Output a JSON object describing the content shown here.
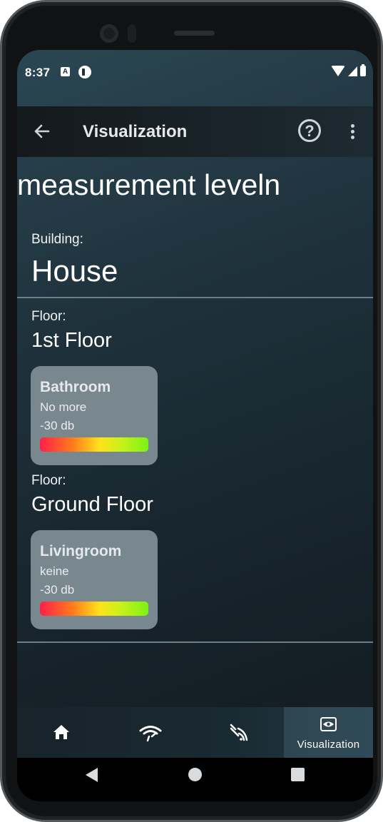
{
  "status_bar": {
    "time": "8:37",
    "notification_icons": [
      "app-a-icon",
      "app-shield-icon"
    ],
    "system_icons": [
      "wifi-icon",
      "cellular-signal-icon",
      "battery-icon"
    ]
  },
  "app_bar": {
    "back_icon": "arrow-left-icon",
    "title": "Visualization",
    "help_icon": "help-circle-icon",
    "help_glyph": "?",
    "more_icon": "more-vertical-icon"
  },
  "page": {
    "heading": "measurement leveln"
  },
  "building": {
    "label": "Building:",
    "name": "House"
  },
  "floors": [
    {
      "label": "Floor:",
      "name": "1st Floor",
      "rooms": [
        {
          "name": "Bathroom",
          "status": "No more",
          "level": "-30 db"
        }
      ]
    },
    {
      "label": "Floor:",
      "name": "Ground Floor",
      "rooms": [
        {
          "name": "Livingroom",
          "status": "keine",
          "level": "-30 db"
        }
      ]
    }
  ],
  "colors": {
    "level_gradient": [
      "#ff1f4a",
      "#ff7a1c",
      "#ffe21a",
      "#c8f21a",
      "#7bf215"
    ],
    "card_background": "#79878f"
  },
  "bottom_nav": {
    "items": [
      {
        "icon": "home-icon",
        "label": ""
      },
      {
        "icon": "wifi-router-icon",
        "label": ""
      },
      {
        "icon": "signal-waves-icon",
        "label": ""
      },
      {
        "icon": "eye-visualization-icon",
        "label": "Visualization",
        "active": true
      }
    ]
  },
  "system_nav": {
    "icons": [
      "nav-back-icon",
      "nav-home-icon",
      "nav-recents-icon"
    ]
  }
}
